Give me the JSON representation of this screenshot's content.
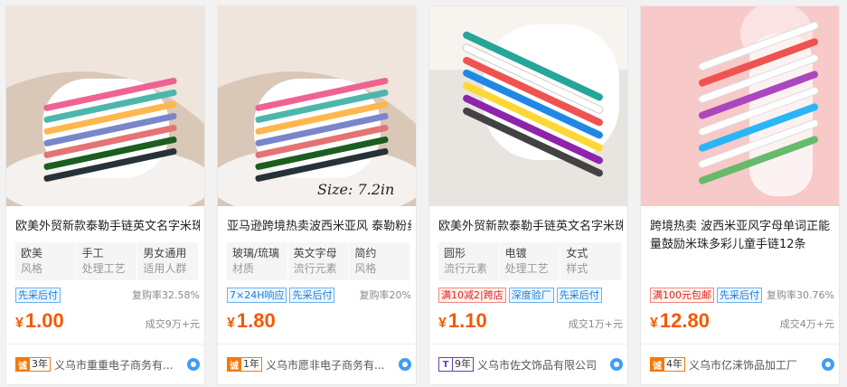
{
  "products": [
    {
      "title": "欧美外贸新款泰勒手链英文名字米珠",
      "attrs": [
        {
          "val": "欧美",
          "key": "风格"
        },
        {
          "val": "手工",
          "key": "处理工艺"
        },
        {
          "val": "男女通用",
          "key": "适用人群"
        }
      ],
      "tags": [
        "先采后付"
      ],
      "tag_colors": [
        "blue"
      ],
      "repeat": "复购率32.58%",
      "price": "1.00",
      "sold": "成交9万+元",
      "years": "3年",
      "badge": "诚",
      "shop": "义乌市重重电子商务有...",
      "watermark": ""
    },
    {
      "title": "亚马逊跨境热卖波西米亚风 泰勒粉丝",
      "attrs": [
        {
          "val": "玻璃/琉璃",
          "key": "材质"
        },
        {
          "val": "英文字母",
          "key": "流行元素"
        },
        {
          "val": "简约",
          "key": "风格"
        }
      ],
      "tags": [
        "7×24H响应",
        "先采后付"
      ],
      "tag_colors": [
        "blue",
        "blue"
      ],
      "repeat": "复购率20%",
      "price": "1.80",
      "sold": "",
      "years": "1年",
      "badge": "诚",
      "shop": "义乌市愿非电子商务有...",
      "watermark": "Size: 7.2in"
    },
    {
      "title": "欧美外贸新款泰勒手链英文名字米珠",
      "attrs": [
        {
          "val": "圆形",
          "key": "流行元素"
        },
        {
          "val": "电镀",
          "key": "处理工艺"
        },
        {
          "val": "女式",
          "key": "样式"
        }
      ],
      "tags": [
        "满10减2|跨店",
        "深度验厂",
        "先采后付"
      ],
      "tag_colors": [
        "red",
        "blue",
        "blue"
      ],
      "repeat": "",
      "price": "1.10",
      "sold": "成交1万+元",
      "years": "9年",
      "badge": "T",
      "shop": "义乌市佐文饰品有限公司",
      "watermark": ""
    },
    {
      "title": "跨境热卖 波西米亚风字母单词正能量鼓励米珠多彩儿童手链12条",
      "attrs": [],
      "tags": [
        "满100元包邮",
        "先采后付"
      ],
      "tag_colors": [
        "red",
        "blue"
      ],
      "repeat": "复购率30.76%",
      "price": "12.80",
      "sold": "成交4万+元",
      "years": "4年",
      "badge": "诚",
      "shop": "义乌市亿涞饰品加工厂",
      "watermark": ""
    }
  ],
  "currency_symbol": "¥",
  "colors": {
    "price": "#f35a00",
    "accent_orange": "#f5790a",
    "tag_blue": "#1a7fd6",
    "tag_red": "#e2231a"
  }
}
